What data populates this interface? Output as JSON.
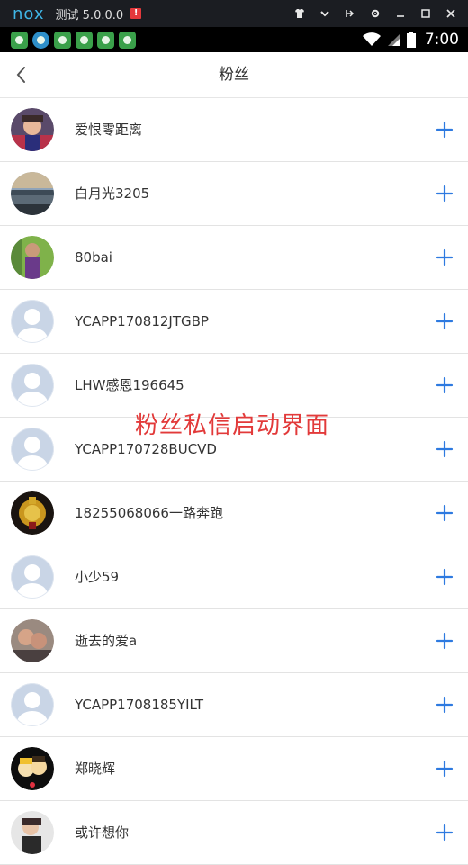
{
  "emulator": {
    "logo": "nox",
    "title": "测试 5.0.0.0",
    "badge": "!",
    "controls": [
      "shirt-icon",
      "chevron-down-icon",
      "pin-icon",
      "gear-icon",
      "minimize-icon",
      "maximize-icon",
      "close-icon"
    ]
  },
  "status_bar": {
    "time": "7:00",
    "notification_count": 6
  },
  "header": {
    "title": "粉丝"
  },
  "fans": [
    {
      "name": "爱恨零距离",
      "avatar": "photo-child"
    },
    {
      "name": "白月光3205",
      "avatar": "photo-landscape"
    },
    {
      "name": "80bai",
      "avatar": "photo-person"
    },
    {
      "name": "YCAPP170812JTGBP",
      "avatar": "default"
    },
    {
      "name": "LHW感恩196645",
      "avatar": "default"
    },
    {
      "name": "YCAPP170728BUCVD",
      "avatar": "default"
    },
    {
      "name": "18255068066一路奔跑",
      "avatar": "photo-gold"
    },
    {
      "name": "小少59",
      "avatar": "default"
    },
    {
      "name": "逝去的爱a",
      "avatar": "photo-couple"
    },
    {
      "name": "YCAPP1708185YILT",
      "avatar": "default"
    },
    {
      "name": "郑晓辉",
      "avatar": "photo-cartoon"
    },
    {
      "name": "或许想你",
      "avatar": "photo-girl"
    }
  ],
  "overlay_caption": "粉丝私信启动界面",
  "colors": {
    "accent": "#2e7ae0",
    "caption": "#e23a3a",
    "default_avatar_bg": "#c9d5e6"
  }
}
